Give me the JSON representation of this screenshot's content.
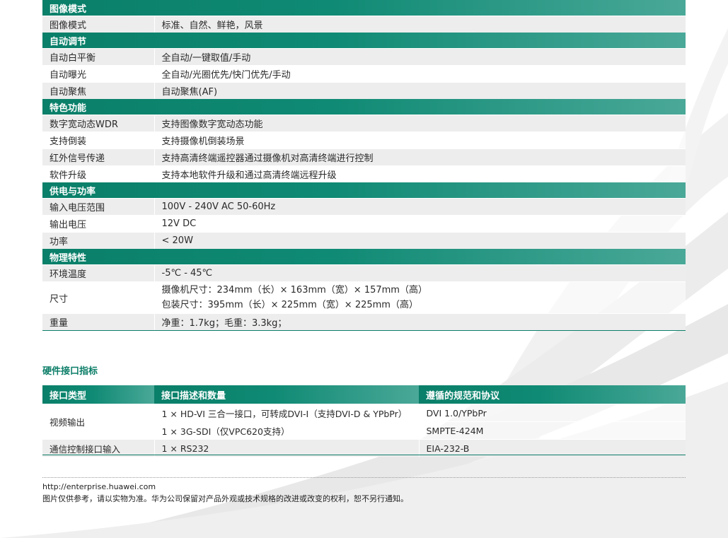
{
  "spec_sections": [
    {
      "title": "图像模式",
      "rows": [
        {
          "label": "图像模式",
          "value": "标准、自然、鲜艳，风景"
        }
      ]
    },
    {
      "title": "自动调节",
      "rows": [
        {
          "label": "自动白平衡",
          "value": "全自动/一键取值/手动"
        },
        {
          "label": "自动曝光",
          "value": "全自动/光圈优先/快门优先/手动"
        },
        {
          "label": "自动聚焦",
          "value": "自动聚焦(AF)"
        }
      ]
    },
    {
      "title": "特色功能",
      "rows": [
        {
          "label": "数字宽动态WDR",
          "value": "支持图像数字宽动态功能"
        },
        {
          "label": "支持倒装",
          "value": "支持摄像机倒装场景"
        },
        {
          "label": "红外信号传递",
          "value": "支持高清终端遥控器通过摄像机对高清终端进行控制"
        },
        {
          "label": "软件升级",
          "value": "支持本地软件升级和通过高清终端远程升级"
        }
      ]
    },
    {
      "title": "供电与功率",
      "rows": [
        {
          "label": "输入电压范围",
          "value": "100V - 240V AC 50-60Hz"
        },
        {
          "label": "输出电压",
          "value": "12V DC"
        },
        {
          "label": "功率",
          "value": "< 20W"
        }
      ]
    },
    {
      "title": "物理特性",
      "rows": [
        {
          "label": "环境温度",
          "value": "-5℃ - 45℃"
        }
      ]
    }
  ],
  "dimension_row": {
    "label": "尺寸",
    "line1": "摄像机尺寸：234mm（长）× 163mm（宽）× 157mm（高）",
    "line2": "包装尺寸：395mm（长）× 225mm（宽）× 225mm（高）"
  },
  "weight_row": {
    "label": "重量",
    "value": "净重：1.7kg；毛重：3.3kg；"
  },
  "interface_title": "硬件接口指标",
  "interface_table": {
    "headers": [
      "接口类型",
      "接口描述和数量",
      "遵循的规范和协议"
    ],
    "video_label": "视频输出",
    "video_rows": [
      {
        "desc": "1 × HD-VI 三合一接口，可转成DVI-I（支持DVI-D & YPbPr）",
        "spec": "DVI 1.0/YPbPr"
      },
      {
        "desc": "1 × 3G-SDI（仅VPC620支持）",
        "spec": "SMPTE-424M"
      }
    ],
    "comm_row": {
      "type": "通信控制接口输入",
      "desc": "1 × RS232",
      "spec": "EIA-232-B"
    }
  },
  "footer": {
    "url": "http://enterprise.huawei.com",
    "note": "图片仅供参考，请以实物为准。华为公司保留对产品外观或技术规格的改进或改变的权利，恕不另行通知。"
  },
  "colors": {
    "accent": "#0c7e68",
    "row_gray": "#ededed"
  }
}
